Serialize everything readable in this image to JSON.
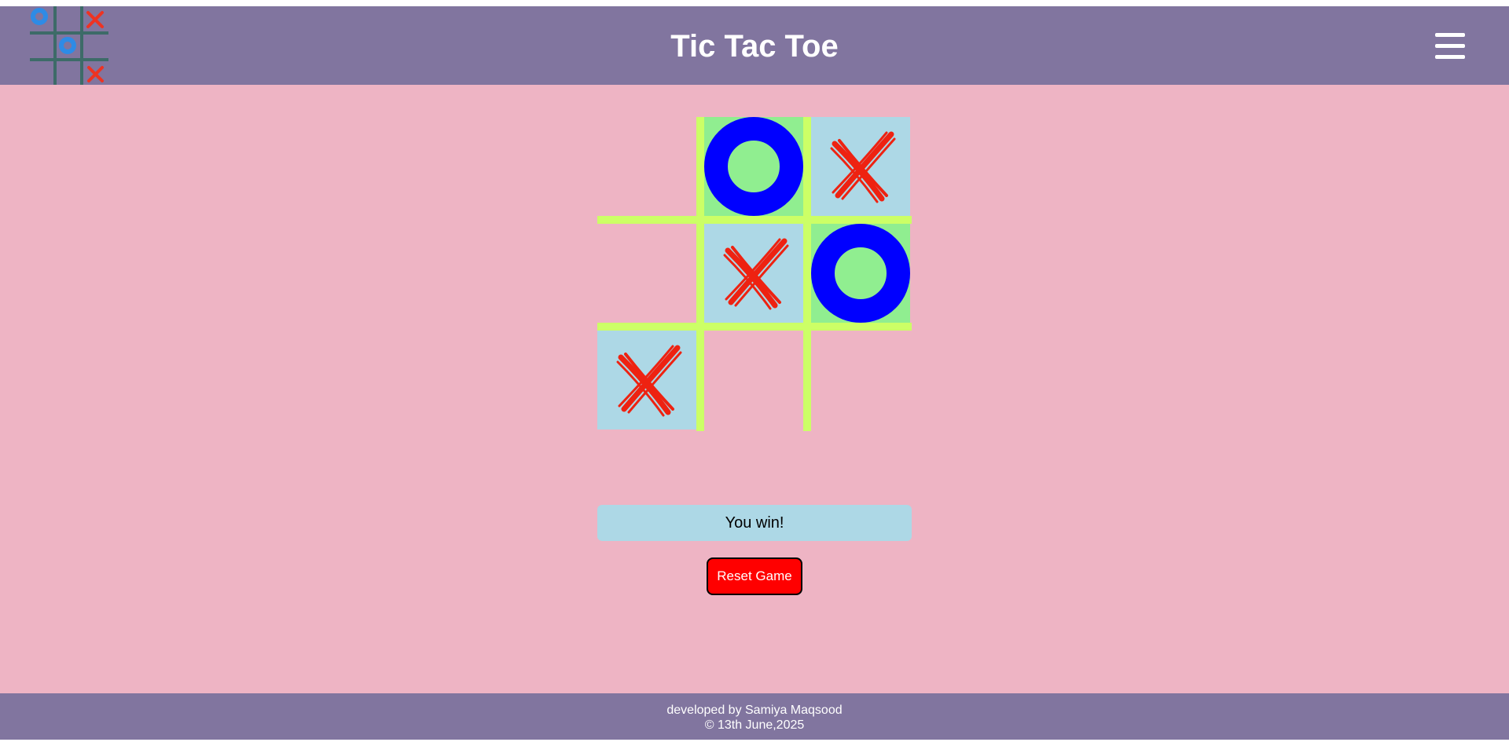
{
  "header": {
    "title": "Tic Tac Toe",
    "background_color": "#81759f",
    "logo_icon": "tic-tac-toe-logo-icon",
    "menu_icon": "hamburger-menu-icon"
  },
  "board": {
    "cells": [
      "",
      "O",
      "X",
      "",
      "X",
      "O",
      "X",
      "",
      ""
    ],
    "x_color": "#ee2211",
    "o_color": "#0000ff",
    "line_color": "#ccff66",
    "x_cell_bg": "#add8e6",
    "o_cell_bg": "#90ee90"
  },
  "status": {
    "message": "You win!"
  },
  "controls": {
    "reset_label": "Reset Game"
  },
  "footer": {
    "line1": "developed by Samiya Maqsood",
    "line2": "© 13th June,2025"
  },
  "page_background": "#eeb4c4"
}
